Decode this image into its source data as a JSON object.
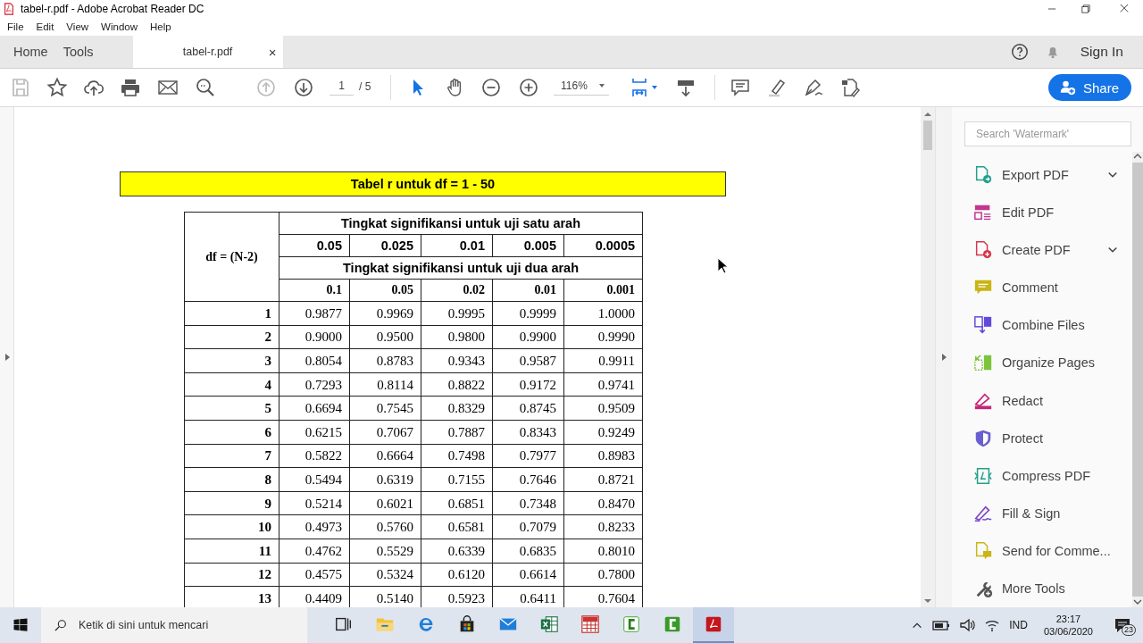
{
  "window": {
    "title": "tabel-r.pdf - Adobe Acrobat Reader DC"
  },
  "menu": [
    "File",
    "Edit",
    "View",
    "Window",
    "Help"
  ],
  "tabs": [
    {
      "label": "Home",
      "selected": false
    },
    {
      "label": "Tools",
      "selected": false
    },
    {
      "label": "tabel-r.pdf",
      "selected": true,
      "close": "×"
    }
  ],
  "sign_in": "Sign In",
  "toolbar": {
    "save_disabled": true,
    "previous_page_disabled": true,
    "page": "1",
    "page_total": "/ 5",
    "select_tool": {
      "selected": true
    },
    "hand_tool": {
      "selected": false
    },
    "zoom": "116%",
    "share": "Share"
  },
  "document": {
    "title": "Tabel r untuk df = 1 - 50",
    "df_header": "df = (N-2)",
    "one_tail_header": "Tingkat signifikansi untuk uji satu arah",
    "one_tail_levels": [
      "0.05",
      "0.025",
      "0.01",
      "0.005",
      "0.0005"
    ],
    "two_tail_header": "Tingkat signifikansi untuk uji dua arah",
    "two_tail_levels": [
      "0.1",
      "0.05",
      "0.02",
      "0.01",
      "0.001"
    ],
    "rows": [
      {
        "df": "1",
        "values": [
          "0.9877",
          "0.9969",
          "0.9995",
          "0.9999",
          "1.0000"
        ]
      },
      {
        "df": "2",
        "values": [
          "0.9000",
          "0.9500",
          "0.9800",
          "0.9900",
          "0.9990"
        ]
      },
      {
        "df": "3",
        "values": [
          "0.8054",
          "0.8783",
          "0.9343",
          "0.9587",
          "0.9911"
        ]
      },
      {
        "df": "4",
        "values": [
          "0.7293",
          "0.8114",
          "0.8822",
          "0.9172",
          "0.9741"
        ]
      },
      {
        "df": "5",
        "values": [
          "0.6694",
          "0.7545",
          "0.8329",
          "0.8745",
          "0.9509"
        ]
      },
      {
        "df": "6",
        "values": [
          "0.6215",
          "0.7067",
          "0.7887",
          "0.8343",
          "0.9249"
        ]
      },
      {
        "df": "7",
        "values": [
          "0.5822",
          "0.6664",
          "0.7498",
          "0.7977",
          "0.8983"
        ]
      },
      {
        "df": "8",
        "values": [
          "0.5494",
          "0.6319",
          "0.7155",
          "0.7646",
          "0.8721"
        ]
      },
      {
        "df": "9",
        "values": [
          "0.5214",
          "0.6021",
          "0.6851",
          "0.7348",
          "0.8470"
        ]
      },
      {
        "df": "10",
        "values": [
          "0.4973",
          "0.5760",
          "0.6581",
          "0.7079",
          "0.8233"
        ]
      },
      {
        "df": "11",
        "values": [
          "0.4762",
          "0.5529",
          "0.6339",
          "0.6835",
          "0.8010"
        ]
      },
      {
        "df": "12",
        "values": [
          "0.4575",
          "0.5324",
          "0.6120",
          "0.6614",
          "0.7800"
        ]
      },
      {
        "df": "13",
        "values": [
          "0.4409",
          "0.5140",
          "0.5923",
          "0.6411",
          "0.7604"
        ]
      }
    ]
  },
  "tools_pane": {
    "search_placeholder": "Search 'Watermark'",
    "items": [
      {
        "label": "Export PDF",
        "color": "#1fa08c",
        "has_menu": true
      },
      {
        "label": "Edit PDF",
        "color": "#c2368f",
        "has_menu": false
      },
      {
        "label": "Create PDF",
        "color": "#d6364c",
        "has_menu": true
      },
      {
        "label": "Comment",
        "color": "#c9b514",
        "has_menu": false
      },
      {
        "label": "Combine Files",
        "color": "#5f4bd8",
        "has_menu": false
      },
      {
        "label": "Organize Pages",
        "color": "#7cc43a",
        "has_menu": false
      },
      {
        "label": "Redact",
        "color": "#c4267a",
        "has_menu": false
      },
      {
        "label": "Protect",
        "color": "#6a5fd0",
        "has_menu": false
      },
      {
        "label": "Compress PDF",
        "color": "#1f9e8a",
        "has_menu": false
      },
      {
        "label": "Fill & Sign",
        "color": "#7a45c8",
        "has_menu": false
      },
      {
        "label": "Send for Comme...",
        "color": "#c9b514",
        "has_menu": false
      },
      {
        "label": "More Tools",
        "color": "#555555",
        "has_menu": false
      }
    ]
  },
  "taskbar": {
    "search_placeholder": "Ketik di sini untuk mencari",
    "apps": [
      {
        "selected": false
      },
      {
        "selected": false
      },
      {
        "selected": false
      },
      {
        "selected": false
      },
      {
        "selected": false
      },
      {
        "selected": false
      },
      {
        "selected": false
      },
      {
        "selected": false
      },
      {
        "selected": false
      },
      {
        "selected": true
      }
    ],
    "language": "IND",
    "time": "23:17",
    "date": "03/06/2020",
    "notifications": "23"
  }
}
